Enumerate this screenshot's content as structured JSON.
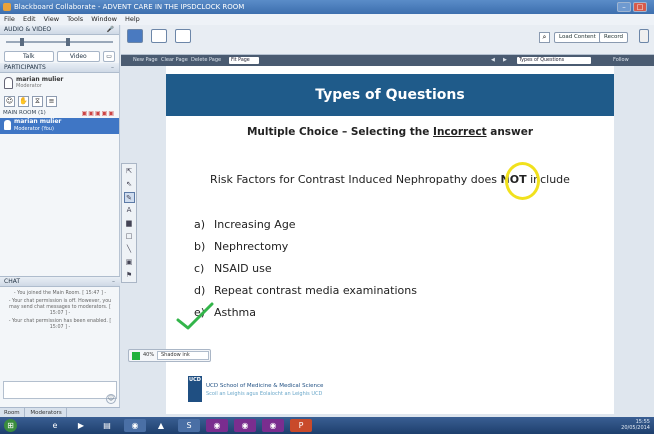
{
  "window": {
    "title": "Blackboard Collaborate - ADVENT CARE IN THE IPSDCLOCK ROOM",
    "controls": [
      "–",
      "□"
    ]
  },
  "menubar": [
    "File",
    "Edit",
    "View",
    "Tools",
    "Window",
    "Help"
  ],
  "left": {
    "av_header": "AUDIO & VIDEO",
    "av_buttons": [
      "Talk",
      "Video"
    ],
    "participants_header": "PARTICIPANTS",
    "me_name": "marian mulier",
    "me_role": "Moderator",
    "main_room": "MAIN ROOM (1)",
    "selected_user": {
      "name": "marian mulier",
      "role": "Moderator (You)"
    },
    "chat_header": "CHAT",
    "chat_messages": [
      "- You joined the Main Room. [ 15:47 ] -",
      "- Your chat permission is off. However, you may send chat messages to moderators. [ 15:07 ] -",
      "- Your chat permission has been enabled. [ 15:07 ] -"
    ],
    "tabs": [
      "Room",
      "Moderators"
    ]
  },
  "content_top": {
    "load_content": "Load Content",
    "record": "Record"
  },
  "pagebar": {
    "new_page": "New Page",
    "clear_page": "Clear Page",
    "delete_page": "Delete Page",
    "fit_page": "Fit Page",
    "slide_select": "Types of Questions",
    "follow": "Follow"
  },
  "slide": {
    "title": "Types of Questions",
    "subtitle_pre": "Multiple Choice – Selecting the ",
    "subtitle_underlined": "Incorrect",
    "subtitle_post": " answer",
    "question_pre": "Risk Factors for Contrast Induced Nephropathy does ",
    "question_bold": "NOT",
    "question_post": " include",
    "options": [
      {
        "letter": "a)",
        "text": "Increasing Age"
      },
      {
        "letter": "b)",
        "text": "Nephrectomy"
      },
      {
        "letter": "c)",
        "text": "NSAID use"
      },
      {
        "letter": "d)",
        "text": "Repeat contrast media examinations"
      },
      {
        "letter": "e)",
        "text": "Asthma"
      }
    ],
    "logo_text": "UCD",
    "footer_line1": "UCD School of Medicine & Medical Science",
    "footer_line2": "Scoil an Leighis agus Eolaíocht an Leighis UCD"
  },
  "zoom": {
    "percent": "40%",
    "select": "Shadow ink",
    "color": "#21b23d"
  },
  "annotation_colors": {
    "circle": "#f1e11d",
    "check": "#33b54a"
  },
  "taskbar": {
    "time": "15:55",
    "date": "20/05/2014"
  }
}
